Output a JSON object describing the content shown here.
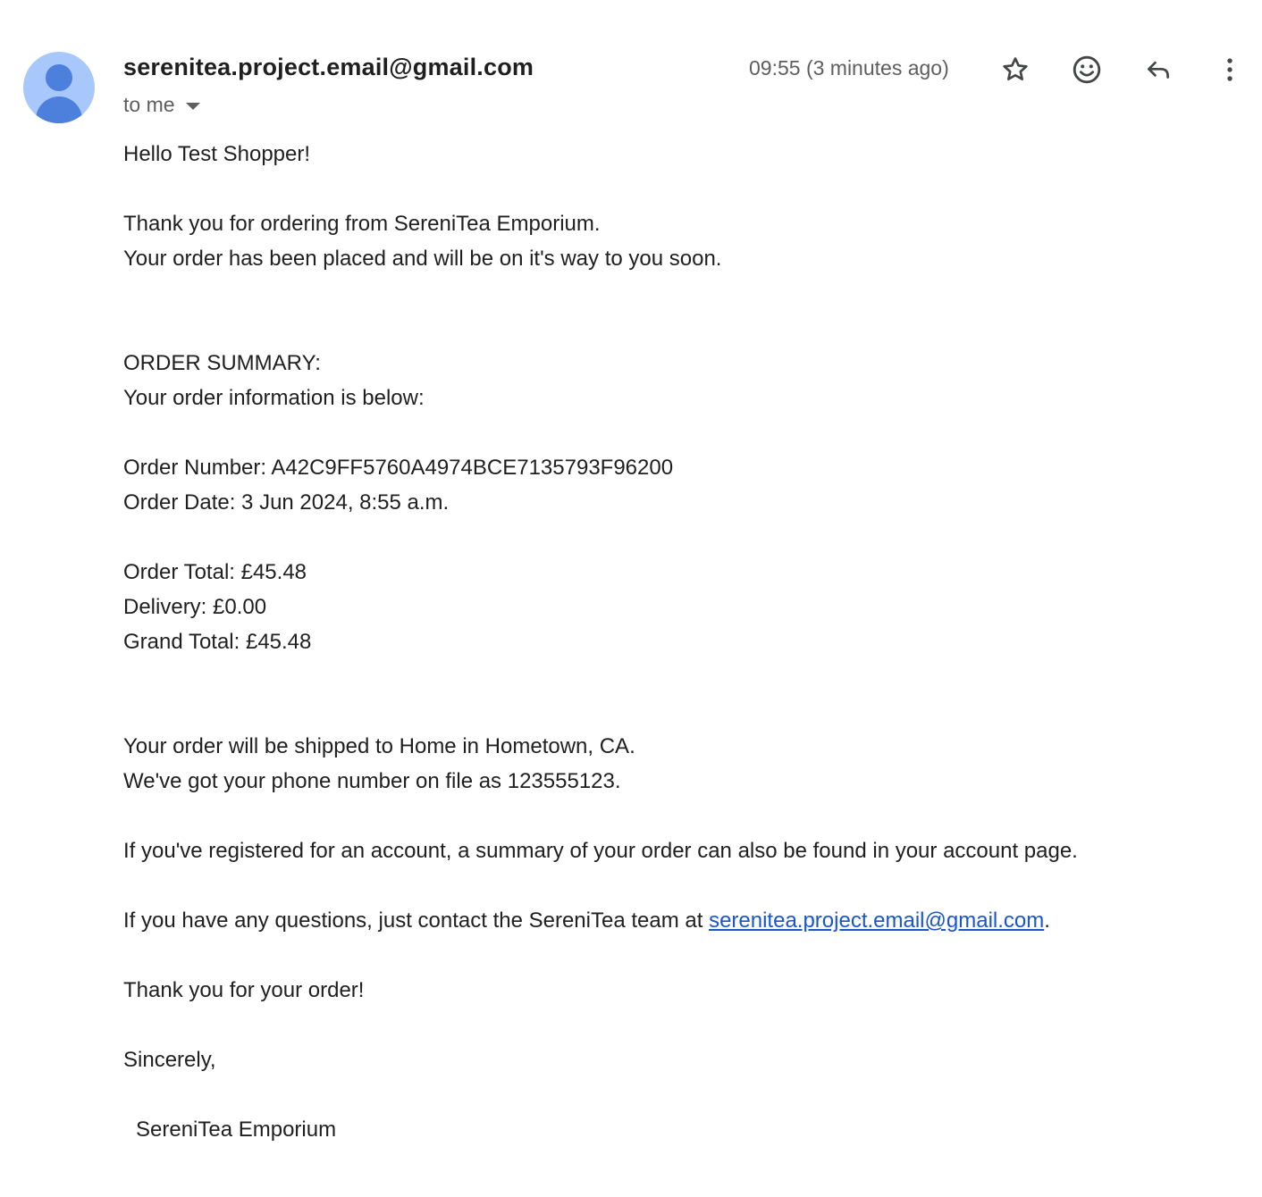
{
  "header": {
    "sender_email": "serenitea.project.email@gmail.com",
    "recipient_label": "to me",
    "timestamp": "09:55 (3 minutes ago)",
    "icons": {
      "star": "star-icon",
      "emoji": "emoji-icon",
      "reply": "reply-icon",
      "more": "more-vert-icon"
    }
  },
  "body": {
    "greeting": "Hello Test Shopper!",
    "thanks_line": "Thank you for ordering from SereniTea Emporium.",
    "placed_line": "Your order has been placed and will be on it's way to you soon.",
    "summary_heading": "ORDER SUMMARY:",
    "summary_intro": "Your order information is below:",
    "order_number": "Order Number: A42C9FF5760A4974BCE7135793F96200",
    "order_date": "Order Date: 3 Jun 2024, 8:55 a.m.",
    "order_total": "Order Total: £45.48",
    "delivery": "Delivery: £0.00",
    "grand_total": "Grand Total: £45.48",
    "shipping_line": "Your order will be shipped to Home in Hometown, CA.",
    "phone_line": "We've got your phone number on file as 123555123.",
    "account_line": "If you've registered for an account, a summary of your order can also be found in your account page.",
    "contact_prefix": "If you have any questions, just contact the SereniTea team at ",
    "contact_email": "serenitea.project.email@gmail.com",
    "contact_suffix": ".",
    "closing_thanks": "Thank you for your order!",
    "sign_off": "Sincerely,",
    "signature": "SereniTea Emporium"
  },
  "colors": {
    "avatar_bg": "#a8c7fa",
    "avatar_fg": "#4d7fdd",
    "link": "#1a55c9",
    "text": "#1f1f1f",
    "muted": "#5e5e5e"
  }
}
